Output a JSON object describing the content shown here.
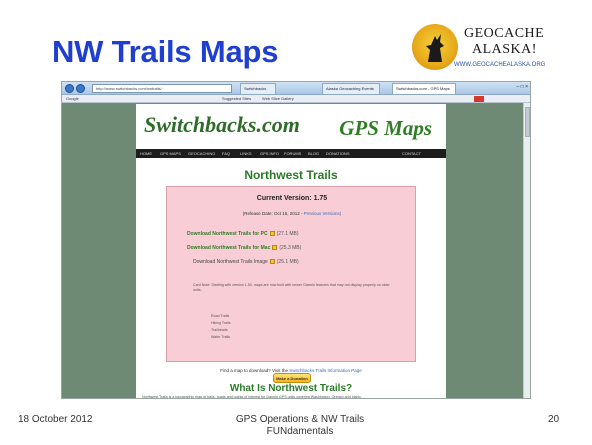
{
  "slide": {
    "title": "NW Trails Maps",
    "footer_date": "18 October 2012",
    "footer_center_line1": "GPS Operations & NW Trails",
    "footer_center_line2": "FUNdamentals",
    "page_number": "20"
  },
  "logo": {
    "line1": "GEOCACHE",
    "line2": "ALASKA!",
    "url": "WWW.GEOCACHEALASKA.ORG",
    "icon": "howling-wolf-icon"
  },
  "browser": {
    "address": "http://www.switchbacks.com/nwtrails/",
    "tabs": [
      {
        "label": "Switchbacks"
      },
      {
        "label": "Alaska Geocaching Events"
      },
      {
        "label": "Switchbacks.com - GPS Maps"
      }
    ],
    "bookmarks": [
      "Google",
      "Suggested Sites",
      "Web Slice Gallery"
    ],
    "window_controls": "– □ ×"
  },
  "site": {
    "logo": "Switchbacks.com",
    "gps_label": "GPS Maps",
    "nav": [
      "HOME",
      "GPS MAPS",
      "GEOCACHING",
      "FAQ",
      "LINKS",
      "GPS INFO",
      "FORUMS",
      "BLOG",
      "DONATIONS",
      "CONTACT"
    ],
    "page_title": "Northwest Trails",
    "current_version": "Current Version: 1.75",
    "release": "(Release Date: Oct 15, 2012 -",
    "release_link": "Previous Versions)",
    "downloads": [
      {
        "label": "Download Northwest Trails for PC",
        "size": "(27.1 MB)"
      },
      {
        "label": "Download Northwest Trails for Mac",
        "size": "(25.3 MB)"
      },
      {
        "label": "Download Northwest Trails Image",
        "size": "(25.1 MB)"
      }
    ],
    "note": "Card Note: Starting with version 1.50, maps are now built with newer Garmin features that may not display properly on older units.",
    "bullets": [
      "Road Trails",
      "Hiking Trails",
      "Trailheads",
      "Water Trails"
    ],
    "donate_label": "Make a Donation",
    "footer_text": "Find a map to download? Visit the",
    "footer_link": "Switchbacks Trails Information Page",
    "what_title": "What Is Northwest Trails?",
    "what_body": "Northwest Trails is a topographic map of trails, roads and points of interest for Garmin GPS units covering Washington, Oregon and Idaho."
  }
}
